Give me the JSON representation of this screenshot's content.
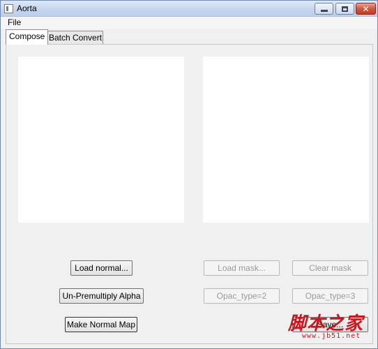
{
  "window": {
    "title": "Aorta"
  },
  "menubar": {
    "items": [
      {
        "label": "File"
      }
    ]
  },
  "tabs": [
    {
      "label": "Compose",
      "active": true
    },
    {
      "label": "Batch Convert",
      "active": false
    }
  ],
  "compose": {
    "left_buttons": {
      "load_normal": "Load normal...",
      "unpremultiply": "Un-Premultiply Alpha",
      "make_normal_map": "Make Normal Map"
    },
    "right_buttons": {
      "load_mask": "Load mask...",
      "clear_mask": "Clear mask",
      "opac_type_2": "Opac_type=2",
      "opac_type_3": "Opac_type=3",
      "save": "Save..."
    }
  },
  "watermark": {
    "brand": "脚本之家",
    "url": "www.jb51.net"
  },
  "colors": {
    "window_bg": "#f0f0f0",
    "close_button": "#c23c20",
    "watermark": "#c8161d"
  }
}
